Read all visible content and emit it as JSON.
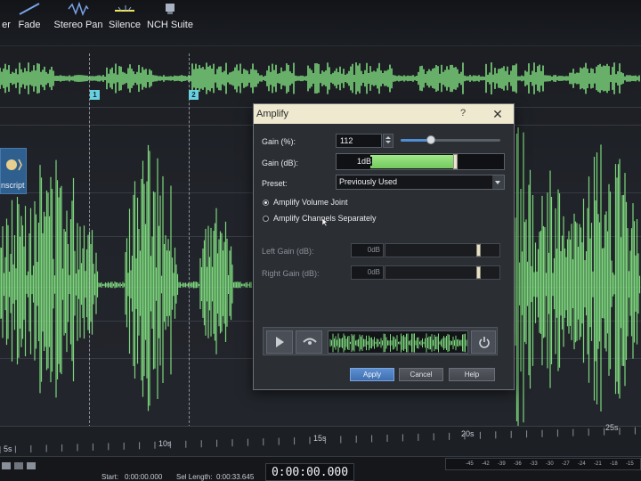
{
  "toolbar": {
    "items": [
      {
        "label": "er",
        "icon": "effect-icon"
      },
      {
        "label": "Fade",
        "icon": "fade-icon"
      },
      {
        "label": "Stereo Pan",
        "icon": "stereo-pan-icon"
      },
      {
        "label": "Silence",
        "icon": "silence-icon"
      },
      {
        "label": "NCH Suite",
        "icon": "nch-suite-icon"
      }
    ]
  },
  "side_tab": {
    "label": "nscript"
  },
  "markers": [
    "1",
    "2"
  ],
  "ruler": {
    "ticks": [
      "5s",
      "10s",
      "15s",
      "20s",
      "25s"
    ]
  },
  "status": {
    "start": "Start:",
    "start_value": "0:00:00.000",
    "sel_length": "Sel Length:",
    "sel_length_value": "0:00:33.645",
    "timecode": "0:00:00.000",
    "meter_ticks": [
      "-45",
      "-42",
      "-39",
      "-36",
      "-33",
      "-30",
      "-27",
      "-24",
      "-21",
      "-18",
      "-15"
    ]
  },
  "dialog": {
    "title": "Amplify",
    "help_glyph": "?",
    "close_glyph": "✕",
    "gain_pct_label": "Gain (%):",
    "gain_pct_value": "112",
    "gain_pct_slider": 0.3,
    "gain_db_label": "Gain (dB):",
    "gain_db_value": "1dB",
    "gain_db_level": 0.62,
    "preset_label": "Preset:",
    "preset_value": "Previously Used",
    "radio_joint": "Amplify Volume Joint",
    "radio_separate": "Amplify Channels Separately",
    "radio_selected": "joint",
    "left_gain_label": "Left Gain (dB):",
    "left_gain_value": "0dB",
    "right_gain_label": "Right Gain (dB):",
    "right_gain_value": "0dB",
    "channel_level": 0.8,
    "apply_label": "Apply",
    "cancel_label": "Cancel",
    "help_label": "Help"
  },
  "colors": {
    "waveform": "#7cd67c",
    "accent": "#4f8fd8",
    "marker": "#6ad0e0"
  }
}
